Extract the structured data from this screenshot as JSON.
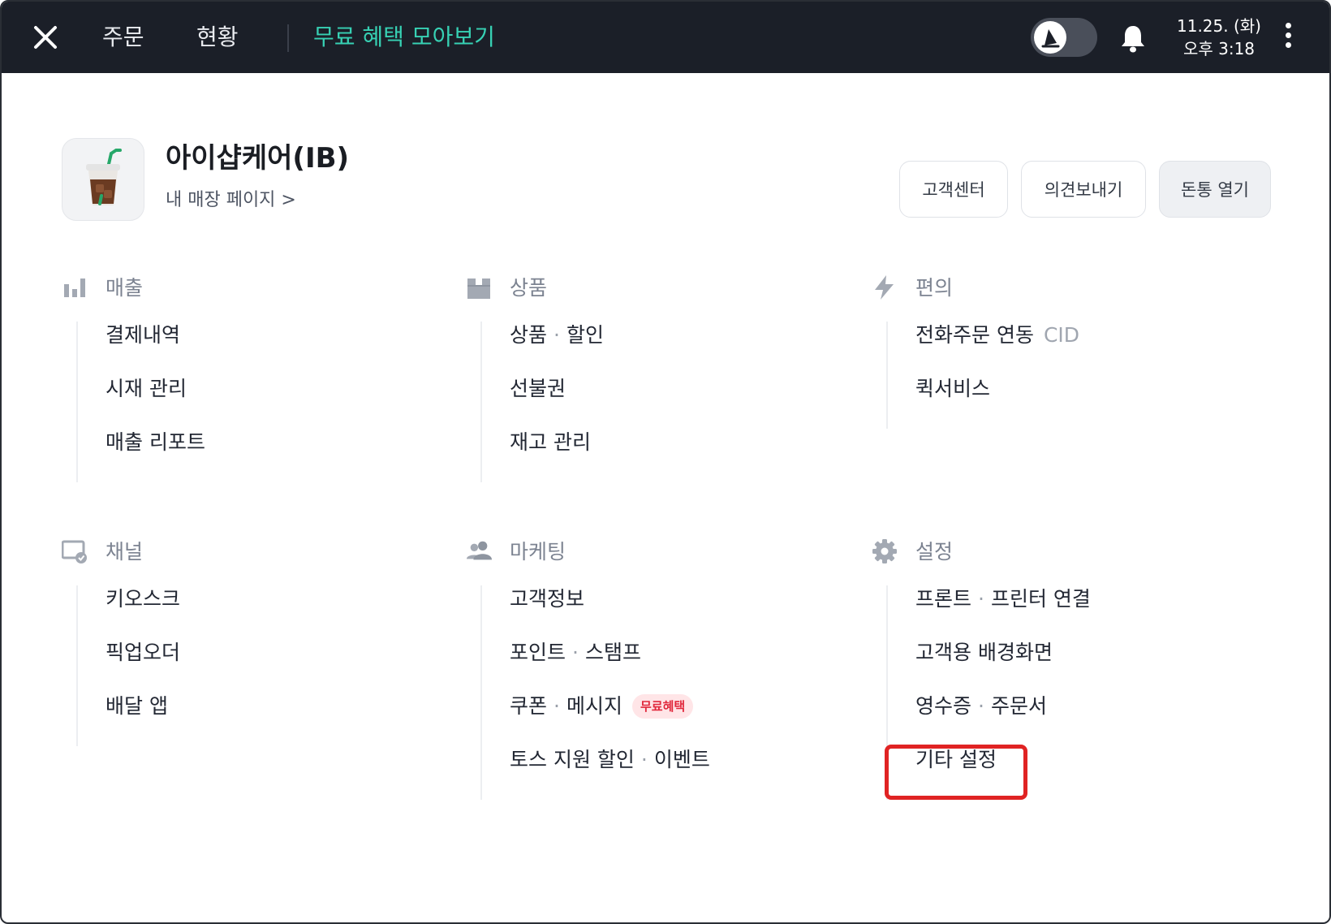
{
  "topbar": {
    "tabs": [
      {
        "label": "주문"
      },
      {
        "label": "현황"
      },
      {
        "label": "무료 혜택 모아보기"
      }
    ],
    "date": "11.25. (화)",
    "time": "오후 3:18",
    "promo_color": "#37d1b4"
  },
  "store": {
    "name": "아이샵케어(IB)",
    "link": "내 매장 페이지 >",
    "logo_icon": "iced-coffee-icon"
  },
  "actions": {
    "support": "고객센터",
    "feedback": "의견보내기",
    "drawer": "돈통 열기"
  },
  "sections": [
    {
      "title": "매출",
      "icon": "bar-chart-icon",
      "items": [
        {
          "label": "결제내역"
        },
        {
          "label": "시재 관리"
        },
        {
          "label": "매출 리포트"
        }
      ]
    },
    {
      "title": "상품",
      "icon": "box-icon",
      "items": [
        {
          "a": "상품",
          "b": "할인"
        },
        {
          "label": "선불권"
        },
        {
          "label": "재고 관리"
        }
      ]
    },
    {
      "title": "편의",
      "icon": "lightning-icon",
      "items": [
        {
          "label": "전화주문 연동",
          "suffix": "CID"
        },
        {
          "label": "퀵서비스"
        }
      ]
    },
    {
      "title": "채널",
      "icon": "screen-touch-icon",
      "items": [
        {
          "label": "키오스크"
        },
        {
          "label": "픽업오더"
        },
        {
          "label": "배달 앱"
        }
      ]
    },
    {
      "title": "마케팅",
      "icon": "people-icon",
      "items": [
        {
          "label": "고객정보"
        },
        {
          "a": "포인트",
          "b": "스탬프"
        },
        {
          "a": "쿠폰",
          "b": "메시지",
          "badge": "무료혜택"
        },
        {
          "a": "토스 지원 할인",
          "b": "이벤트"
        }
      ]
    },
    {
      "title": "설정",
      "icon": "gear-icon",
      "items": [
        {
          "a": "프론트",
          "b": "프린터 연결"
        },
        {
          "label": "고객용 배경화면"
        },
        {
          "a": "영수증",
          "b": "주문서"
        },
        {
          "label": "기타 설정"
        }
      ]
    }
  ],
  "dot_separator": "·",
  "highlight_color": "#e02323"
}
